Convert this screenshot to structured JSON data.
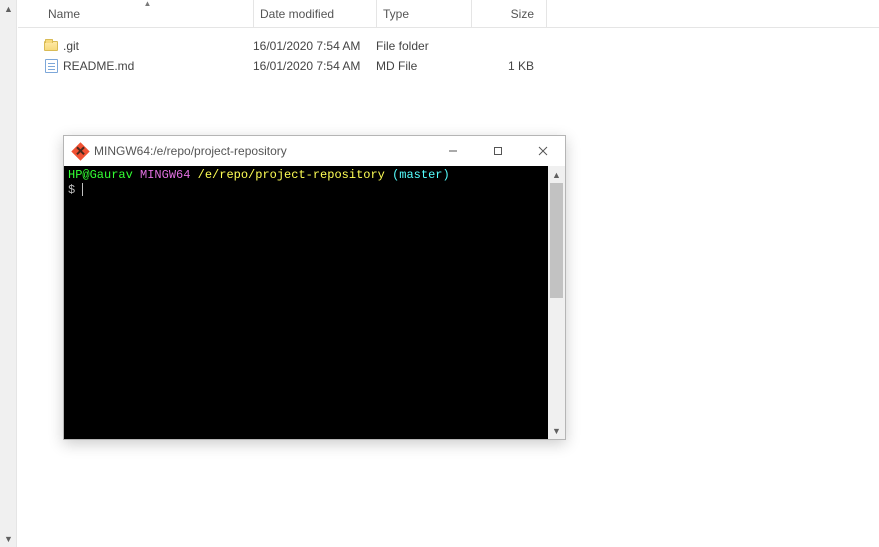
{
  "explorer": {
    "columns": {
      "name": "Name",
      "date": "Date modified",
      "type": "Type",
      "size": "Size"
    },
    "rows": [
      {
        "icon": "folder",
        "name": ".git",
        "date": "16/01/2020 7:54 AM",
        "type": "File folder",
        "size": ""
      },
      {
        "icon": "mdfile",
        "name": "README.md",
        "date": "16/01/2020 7:54 AM",
        "type": "MD File",
        "size": "1 KB"
      }
    ]
  },
  "terminal": {
    "title": "MINGW64:/e/repo/project-repository",
    "prompt": {
      "userhost": "HP@Gaurav",
      "env": "MINGW64",
      "path": "/e/repo/project-repository",
      "branch": "(master)",
      "symbol": "$"
    }
  }
}
